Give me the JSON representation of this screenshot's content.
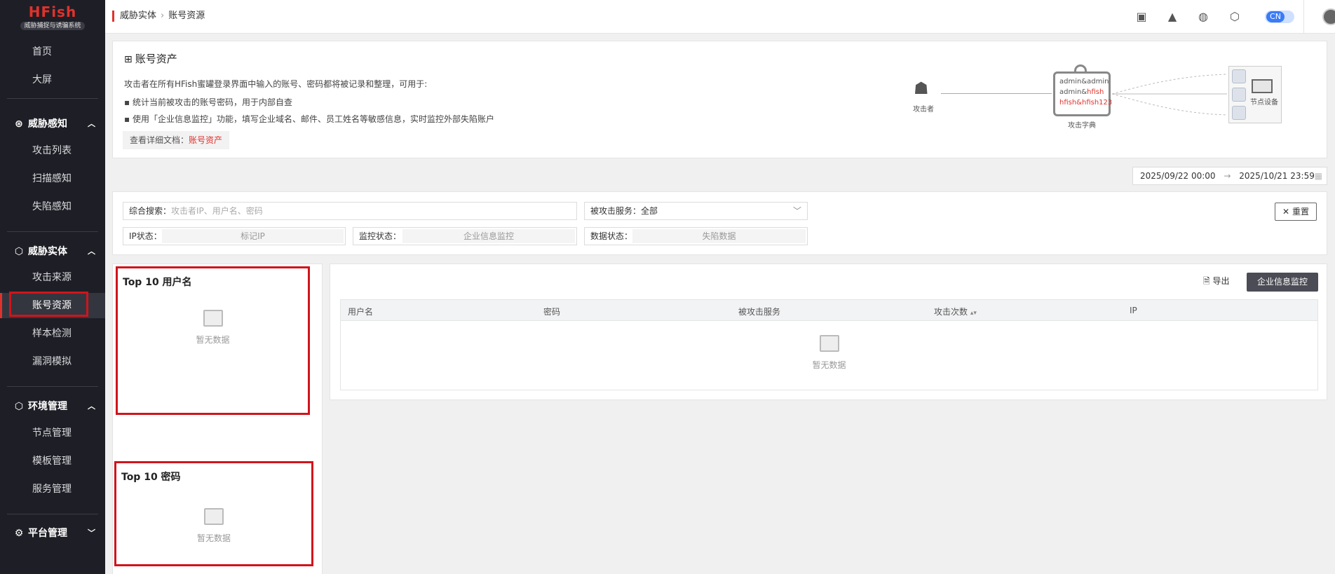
{
  "app": {
    "logo": "HFish",
    "tagline": "威胁捕捉与诱骗系统"
  },
  "sidebar": {
    "home": "首页",
    "screen": "大屏",
    "groups": [
      {
        "label": "威胁感知",
        "items": [
          "攻击列表",
          "扫描感知",
          "失陷感知"
        ]
      },
      {
        "label": "威胁实体",
        "items": [
          "攻击来源",
          "账号资源",
          "样本检测",
          "漏洞模拟"
        ]
      },
      {
        "label": "环境管理",
        "items": [
          "节点管理",
          "模板管理",
          "服务管理"
        ]
      },
      {
        "label": "平台管理",
        "items": []
      }
    ],
    "active": "账号资源"
  },
  "topbar": {
    "breadcrumb": [
      "威胁实体",
      "账号资源"
    ],
    "lang": "CN",
    "icons": [
      "book-icon",
      "rocket-icon",
      "wechat-icon",
      "hexagon-icon"
    ]
  },
  "intro": {
    "title": "账号资产",
    "desc": "攻击者在所有HFish蜜罐登录界面中输入的账号、密码都将被记录和整理，可用于:",
    "bullet1": "统计当前被攻击的账号密码，用于内部自查",
    "bullet2": "使用「企业信息监控」功能，填写企业域名、邮件、员工姓名等敏感信息，实时监控外部失陷账户",
    "doc_label": "查看详细文档：",
    "doc_link": "账号资产",
    "diagram": {
      "attacker": "攻击者",
      "dict_lines": [
        "admin&admin",
        "admin&",
        "hfish",
        "hfish&hfish123",
        "..."
      ],
      "dict_label": "攻击字典",
      "node_label": "节点设备"
    }
  },
  "daterange": {
    "start": "2025/09/22 00:00",
    "arrow": "→",
    "end": "2025/10/21 23:59"
  },
  "filters": {
    "search_label": "综合搜索：",
    "search_placeholder": "攻击者IP、用户名、密码",
    "service_label": "被攻击服务：",
    "service_value": "全部",
    "ip_label": "IP状态：",
    "ip_value": "标记IP",
    "monitor_label": "监控状态：",
    "monitor_value": "企业信息监控",
    "data_label": "数据状态：",
    "data_value": "失陷数据",
    "reset": "重置"
  },
  "top_users": {
    "title": "Top 10 用户名",
    "empty": "暂无数据"
  },
  "top_passwords": {
    "title": "Top 10 密码",
    "empty": "暂无数据"
  },
  "table": {
    "export": "导出",
    "monitor_btn": "企业信息监控",
    "columns": [
      "用户名",
      "密码",
      "被攻击服务",
      "攻击次数",
      "IP"
    ],
    "empty": "暂无数据"
  },
  "colors": {
    "accent": "#e0322c",
    "sidebar": "#1e1f26",
    "toggle": "#3a7bf7"
  }
}
